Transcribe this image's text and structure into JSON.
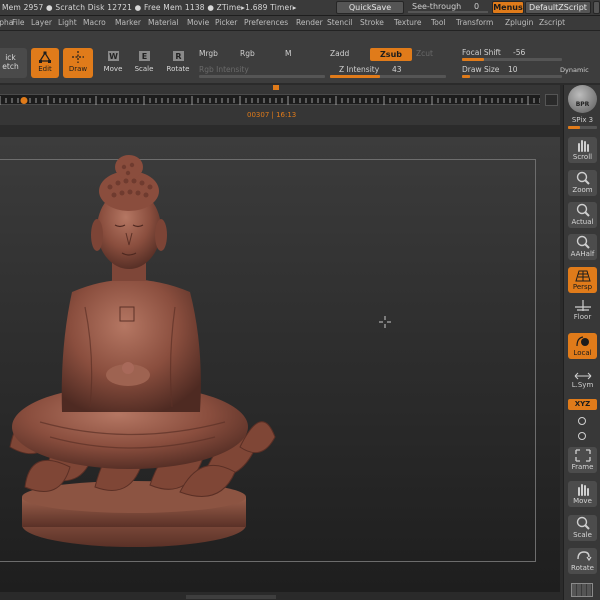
{
  "topbar": {
    "status_text": "Mem 2957 ● Scratch Disk 12721 ● Free Mem 1138 ● ZTime▸1.689 Timer▸",
    "quicksave": "QuickSave",
    "see_through_label": "See-through",
    "see_through_value": "0",
    "menus_button": "Menus",
    "zscript_button": "DefaultZScript"
  },
  "menu": {
    "items": [
      "Alpha",
      "File",
      "Layer",
      "Light",
      "Macro",
      "Marker",
      "Material",
      "Movie",
      "Picker",
      "Preferences",
      "Render",
      "Stencil",
      "Stroke",
      "Texture",
      "Tool",
      "Transform",
      "Zplugin",
      "Zscript"
    ]
  },
  "toolbar": {
    "quick_sketch_1": "ick",
    "quick_sketch_2": "etch",
    "edit": "Edit",
    "draw": "Draw",
    "move": "Move",
    "scale": "Scale",
    "rotate": "Rotate",
    "mrgb": "Mrgb",
    "rgb": "Rgb",
    "m": "M",
    "rgb_intensity": "Rgb Intensity",
    "zadd": "Zadd",
    "zsub": "Zsub",
    "zcut": "Zcut",
    "z_intensity_label": "Z Intensity",
    "z_intensity_value": "43",
    "focal_shift_label": "Focal Shift",
    "focal_shift_value": "-56",
    "draw_size_label": "Draw Size",
    "draw_size_value": "10",
    "dynamic": "Dynamic"
  },
  "timeline": {
    "timecode": "00307 | 16:13"
  },
  "rightbar": {
    "bpr": "BPR",
    "spix": "SPix 3",
    "buttons": [
      "Scroll",
      "Zoom",
      "Actual",
      "AAHalf",
      "Persp",
      "Floor",
      "Local",
      "L.Sym",
      "XYZ",
      "Frame",
      "Move",
      "Scale",
      "Rotate"
    ]
  },
  "colors": {
    "accent": "#e07b1a",
    "sculpt": "#8a4e3e"
  },
  "icons": {
    "cursor": "crosshair-icon"
  }
}
